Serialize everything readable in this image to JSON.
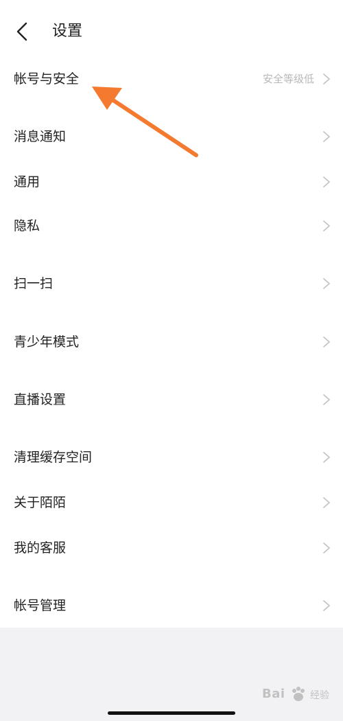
{
  "header": {
    "title": "设置"
  },
  "settings": {
    "items": [
      {
        "label": "帐号与安全",
        "value": "安全等级低"
      },
      {
        "label": "消息通知",
        "value": ""
      },
      {
        "label": "通用",
        "value": ""
      },
      {
        "label": "隐私",
        "value": ""
      },
      {
        "label": "扫一扫",
        "value": ""
      },
      {
        "label": "青少年模式",
        "value": ""
      },
      {
        "label": "直播设置",
        "value": ""
      },
      {
        "label": "清理缓存空间",
        "value": ""
      },
      {
        "label": "关于陌陌",
        "value": ""
      },
      {
        "label": "我的客服",
        "value": ""
      },
      {
        "label": "帐号管理",
        "value": ""
      }
    ]
  },
  "watermark": {
    "brand": "Bai",
    "suffix": "经验"
  },
  "colors": {
    "annotation_arrow": "#f47a30",
    "chevron": "#c4c4c4",
    "secondary_text": "#b8b8b8",
    "background": "#f2f2f5"
  }
}
